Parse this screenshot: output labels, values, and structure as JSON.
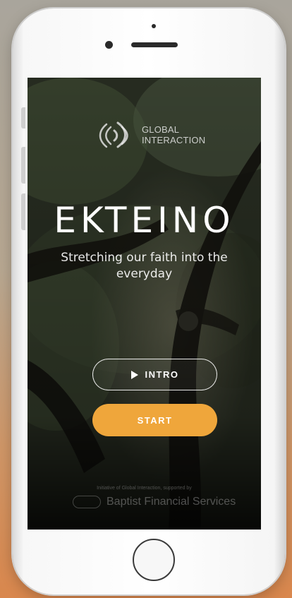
{
  "app": {
    "title": "EKTEINO",
    "tagline": "Stretching our faith into the everyday"
  },
  "brand": {
    "line1": "GLOBAL",
    "line2": "INTERACTION",
    "logo_icon": "sound-waves-logo-icon"
  },
  "buttons": {
    "intro_label": "INTRO",
    "intro_icon": "play-icon",
    "start_label": "START"
  },
  "footer": {
    "credit": "Initiative of Global Interaction, supported by",
    "org_name": "Baptist Financial Services"
  },
  "colors": {
    "accent": "#efa63b",
    "screen_background": "#17150f",
    "text": "#ffffff"
  }
}
